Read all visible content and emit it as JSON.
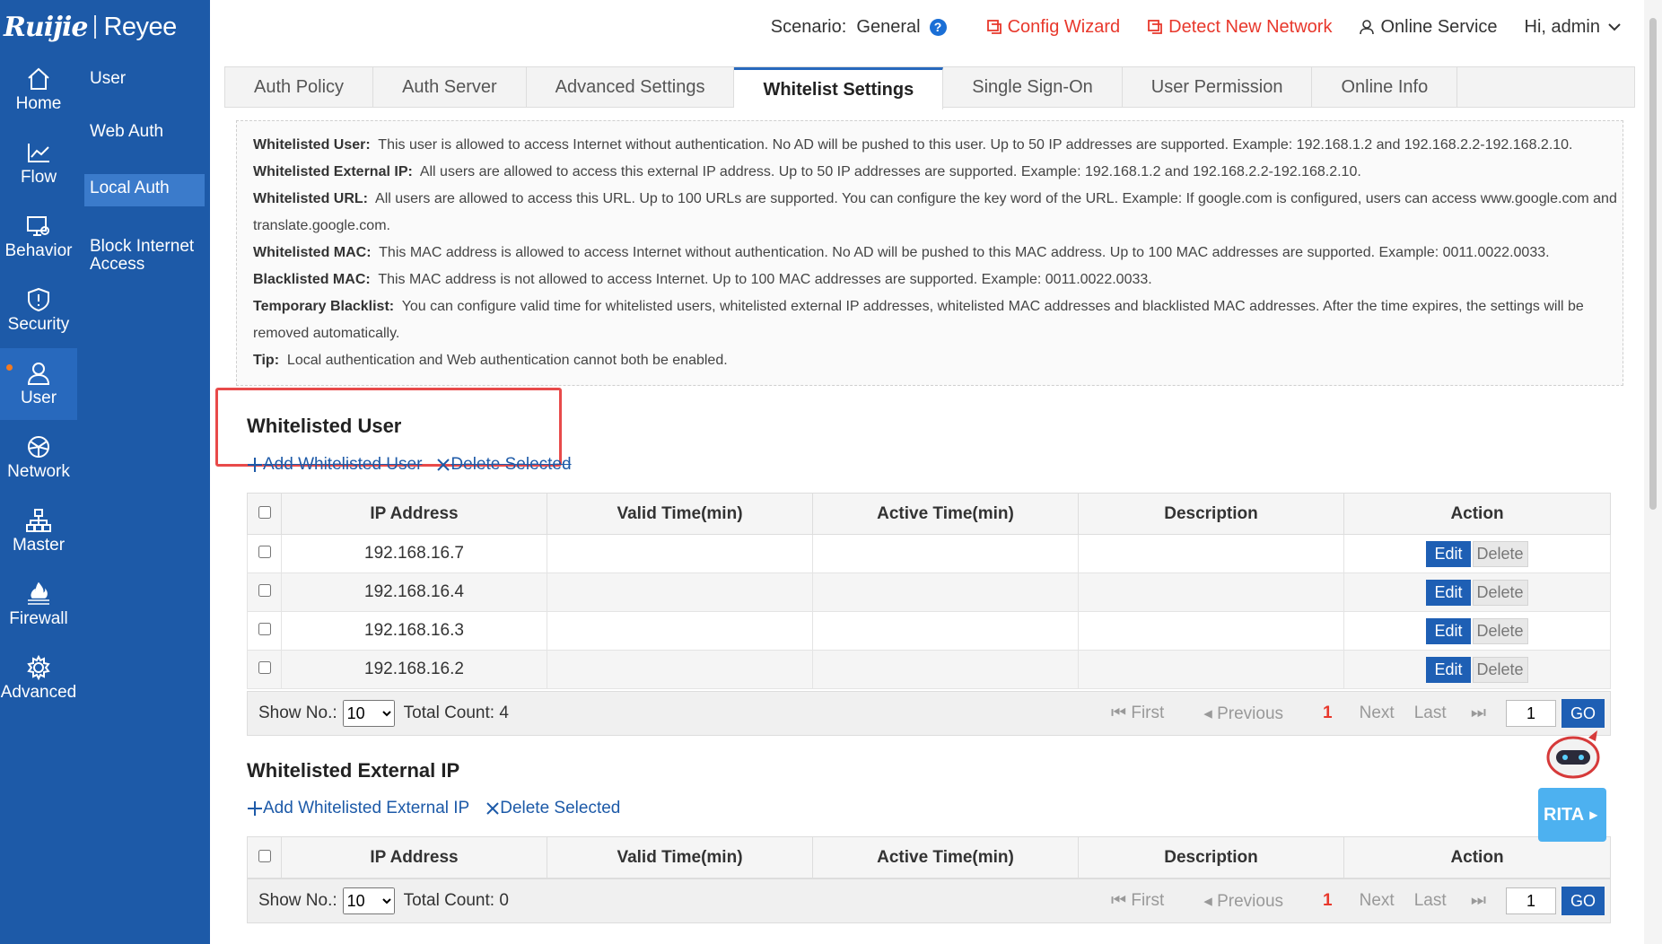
{
  "brand": {
    "logo1": "Ruijie",
    "logo2": "Reyee"
  },
  "rail": [
    {
      "label": "Home",
      "icon": "home-icon"
    },
    {
      "label": "Flow",
      "icon": "flow-icon"
    },
    {
      "label": "Behavior",
      "icon": "behavior-icon"
    },
    {
      "label": "Security",
      "icon": "security-icon"
    },
    {
      "label": "User",
      "icon": "user-icon",
      "active": true
    },
    {
      "label": "Network",
      "icon": "network-icon"
    },
    {
      "label": "Master",
      "icon": "master-icon"
    },
    {
      "label": "Firewall",
      "icon": "firewall-icon"
    },
    {
      "label": "Advanced",
      "icon": "advanced-icon"
    }
  ],
  "submenu": [
    {
      "label": "User"
    },
    {
      "label": "Web Auth"
    },
    {
      "label": "Local Auth",
      "active": true
    },
    {
      "label": "Block Internet Access"
    }
  ],
  "header": {
    "scenario_label": "Scenario:",
    "scenario_value": "General",
    "help": "?",
    "config_wizard": "Config Wizard",
    "detect_network": "Detect New Network",
    "online_service": "Online Service",
    "greeting": "Hi, admin"
  },
  "tabs": [
    {
      "label": "Auth Policy"
    },
    {
      "label": "Auth Server"
    },
    {
      "label": "Advanced Settings"
    },
    {
      "label": "Whitelist Settings",
      "active": true
    },
    {
      "label": "Single Sign-On"
    },
    {
      "label": "User Permission"
    },
    {
      "label": "Online Info"
    }
  ],
  "notes": [
    {
      "key": "Whitelisted User:",
      "text": "This user is allowed to access Internet without authentication. No AD will be pushed to this user. Up to 50 IP addresses are supported. Example: 192.168.1.2 and 192.168.2.2-192.168.2.10."
    },
    {
      "key": "Whitelisted External IP:",
      "text": "All users are allowed to access this external IP address. Up to 50 IP addresses are supported. Example: 192.168.1.2 and 192.168.2.2-192.168.2.10."
    },
    {
      "key": "Whitelisted URL:",
      "text": "All users are allowed to access this URL. Up to 100 URLs are supported. You can configure the key word of the URL. Example: If google.com is configured, users can access www.google.com and translate.google.com."
    },
    {
      "key": "Whitelisted MAC:",
      "text": "This MAC address is allowed to access Internet without authentication. No AD will be pushed to this MAC address. Up to 100 MAC addresses are supported. Example: 0011.0022.0033."
    },
    {
      "key": "Blacklisted MAC:",
      "text": "This MAC address is not allowed to access Internet. Up to 100 MAC addresses are supported. Example: 0011.0022.0033."
    },
    {
      "key": "Temporary Blacklist:",
      "text": "You can configure valid time for whitelisted users, whitelisted external IP addresses, whitelisted MAC addresses and blacklisted MAC addresses. After the time expires, the settings will be removed automatically."
    },
    {
      "key": "Tip:",
      "text": "Local authentication and Web authentication cannot both be enabled."
    }
  ],
  "columns": [
    "IP Address",
    "Valid Time(min)",
    "Active Time(min)",
    "Description",
    "Action"
  ],
  "buttons": {
    "edit": "Edit",
    "delete": "Delete"
  },
  "pager_labels": {
    "show_no": "Show No.:",
    "total_prefix": "Total Count:",
    "first": "First",
    "previous": "Previous",
    "next": "Next",
    "last": "Last",
    "go": "GO"
  },
  "whitelisted_user": {
    "title": "Whitelisted User",
    "add": "Add Whitelisted User",
    "delete_selected": "Delete Selected",
    "rows": [
      {
        "ip": "192.168.16.7",
        "valid": "",
        "active": "",
        "desc": ""
      },
      {
        "ip": "192.168.16.4",
        "valid": "",
        "active": "",
        "desc": ""
      },
      {
        "ip": "192.168.16.3",
        "valid": "",
        "active": "",
        "desc": ""
      },
      {
        "ip": "192.168.16.2",
        "valid": "",
        "active": "",
        "desc": ""
      }
    ],
    "page_size": "10",
    "total_count": "4",
    "current_page": "1",
    "page_input": "1"
  },
  "whitelisted_external_ip": {
    "title": "Whitelisted External IP",
    "add": "Add Whitelisted External IP",
    "delete_selected": "Delete Selected",
    "page_size": "10",
    "total_count": "0",
    "current_page": "1",
    "page_input": "1"
  },
  "rita": {
    "label": "RITA"
  },
  "colors": {
    "primary": "#1d5aa8",
    "accent_red": "#e8382c",
    "highlight_box": "#e84a4a"
  }
}
